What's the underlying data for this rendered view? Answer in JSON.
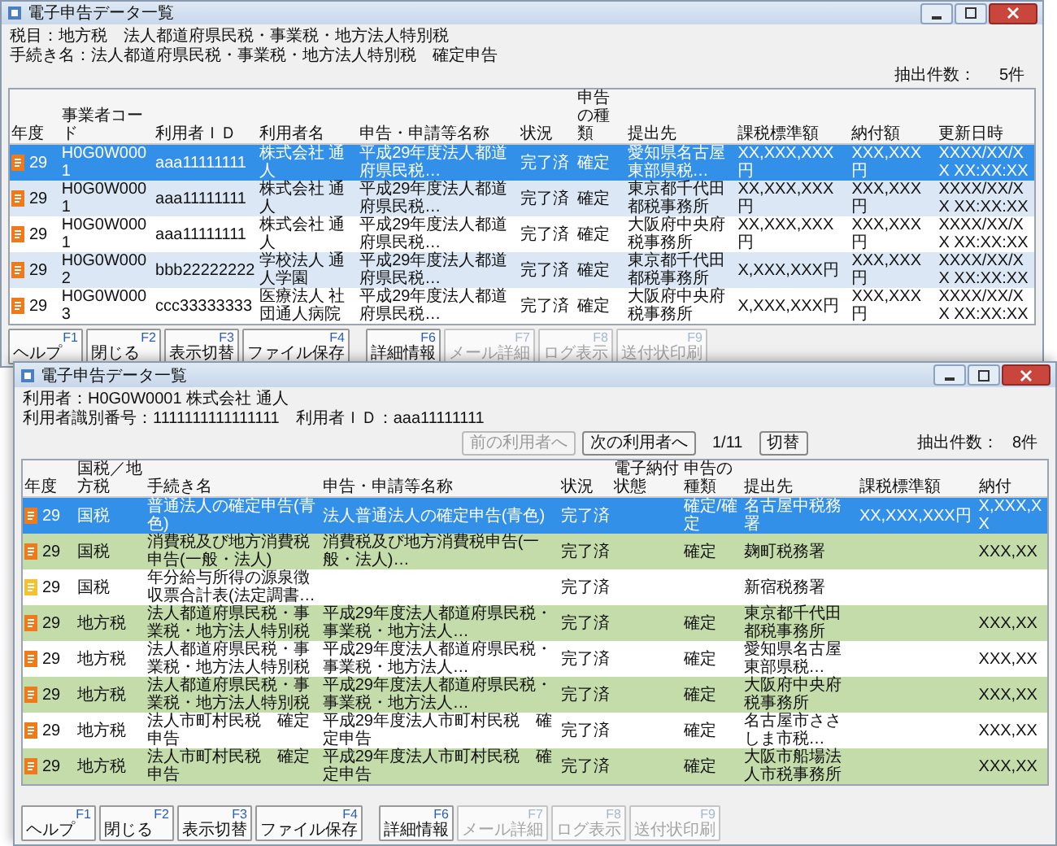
{
  "back_window": {
    "title": "電子申告データ一覧",
    "info_lines": [
      "税目：地方税　法人都道府県民税・事業税・地方法人特別税",
      "手続き名：法人都道府県民税・事業税・地方法人特別税　確定申告"
    ],
    "count_label": "抽出件数：",
    "count": "5件",
    "table": {
      "columns": [
        "年度",
        "事業者コード",
        "利用者ＩＤ",
        "利用者名",
        "申告・申請等名称",
        "状況",
        "申告の種類",
        "提出先",
        "課税標準額",
        "納付額",
        "更新日時"
      ],
      "rows": [
        {
          "selected": true,
          "kind": "report",
          "year": "29",
          "business_code": "H0G0W0001",
          "user_id": "aaa11111111",
          "user_name": "株式会社 通人",
          "report_name": "平成29年度法人都道府県民税…",
          "status": "完了済",
          "return_type": "確定",
          "submit_to": "愛知県名古屋東部県税…",
          "tax_base": "XX,XXX,XXX円",
          "tax_due": "XXX,XXX円",
          "updated": "XXXX/XX/XX XX:XX:XX"
        },
        {
          "selected": false,
          "kind": "report",
          "year": "29",
          "business_code": "H0G0W0001",
          "user_id": "aaa11111111",
          "user_name": "株式会社 通人",
          "report_name": "平成29年度法人都道府県民税…",
          "status": "完了済",
          "return_type": "確定",
          "submit_to": "東京都千代田都税事務所",
          "tax_base": "XX,XXX,XXX円",
          "tax_due": "XXX,XXX円",
          "updated": "XXXX/XX/XX XX:XX:XX"
        },
        {
          "selected": false,
          "kind": "report",
          "year": "29",
          "business_code": "H0G0W0001",
          "user_id": "aaa11111111",
          "user_name": "株式会社 通人",
          "report_name": "平成29年度法人都道府県民税…",
          "status": "完了済",
          "return_type": "確定",
          "submit_to": "大阪府中央府税事務所",
          "tax_base": "XX,XXX,XXX円",
          "tax_due": "XXX,XXX円",
          "updated": "XXXX/XX/XX XX:XX:XX"
        },
        {
          "selected": false,
          "kind": "report",
          "year": "29",
          "business_code": "H0G0W0002",
          "user_id": "bbb22222222",
          "user_name": "学校法人 通人学園",
          "report_name": "平成29年度法人都道府県民税…",
          "status": "完了済",
          "return_type": "確定",
          "submit_to": "東京都千代田都税事務所",
          "tax_base": "X,XXX,XXX円",
          "tax_due": "XXX,XXX円",
          "updated": "XXXX/XX/XX XX:XX:XX"
        },
        {
          "selected": false,
          "kind": "report",
          "year": "29",
          "business_code": "H0G0W0003",
          "user_id": "ccc33333333",
          "user_name": "医療法人 社団通人病院",
          "report_name": "平成29年度法人都道府県民税…",
          "status": "完了済",
          "return_type": "確定",
          "submit_to": "大阪府中央府税事務所",
          "tax_base": "X,XXX,XXX円",
          "tax_due": "XXX,XXX円",
          "updated": "XXXX/XX/XX XX:XX:XX"
        }
      ]
    },
    "function_key_groups": [
      {
        "keys": [
          {
            "key": "F1",
            "label": "ヘルプ",
            "disabled": false
          },
          {
            "key": "F2",
            "label": "閉じる",
            "disabled": false
          },
          {
            "key": "F3",
            "label": "表示切替",
            "disabled": false
          },
          {
            "key": "F4",
            "label": "ファイル保存",
            "disabled": false
          }
        ]
      },
      {
        "keys": [
          {
            "key": "F6",
            "label": "詳細情報",
            "disabled": false
          },
          {
            "key": "F7",
            "label": "メール詳細",
            "disabled": true
          },
          {
            "key": "F8",
            "label": "ログ表示",
            "disabled": true
          },
          {
            "key": "F9",
            "label": "送付状印刷",
            "disabled": true
          }
        ]
      }
    ]
  },
  "front_window": {
    "title": "電子申告データ一覧",
    "info_lines": [
      "利用者：H0G0W0001 株式会社 通人",
      "利用者識別番号：1111111111111111　利用者ＩＤ：aaa11111111"
    ],
    "nav_buttons": [
      {
        "label": "前の利用者へ",
        "disabled": true
      },
      {
        "label": "次の利用者へ",
        "disabled": false
      }
    ],
    "page": "1/11",
    "switch_button": "切替",
    "count_label": "抽出件数：",
    "count": "8件",
    "table": {
      "columns": [
        "年度",
        "国税／地方税",
        "手続き名",
        "申告・申請等名称",
        "状況",
        "電子納付状態",
        "申告の種類",
        "提出先",
        "課税標準額",
        "納付"
      ],
      "rows": [
        {
          "selected": true,
          "kind": "report",
          "year": "29",
          "tax_class": "国税",
          "procedure": "普通法人の確定申告(青色)",
          "report_name": "法人普通法人の確定申告(青色)",
          "status": "完了済",
          "return_type": "確定/確定",
          "submit_to": "名古屋中税務署",
          "tax_base": "XX,XXX,XXX円",
          "tax_due": "X,XXX,XX"
        },
        {
          "selected": false,
          "kind": "report",
          "year": "29",
          "tax_class": "国税",
          "procedure": "消費税及び地方消費税申告(一般・法人)",
          "report_name": "消費税及び地方消費税申告(一般・法人)…",
          "status": "完了済",
          "return_type": "確定",
          "submit_to": "麹町税務署",
          "tax_due": "XXX,XX"
        },
        {
          "selected": false,
          "kind": "notice",
          "year": "29",
          "tax_class": "国税",
          "procedure": "年分給与所得の源泉徴収票合計表(法定調書…",
          "status": "完了済",
          "submit_to": "新宿税務署"
        },
        {
          "selected": false,
          "kind": "report",
          "year": "29",
          "tax_class": "地方税",
          "procedure": "法人都道府県民税・事業税・地方法人特別税",
          "report_name": "平成29年度法人都道府県民税・事業税・地方法人…",
          "status": "完了済",
          "return_type": "確定",
          "submit_to": "東京都千代田都税事務所",
          "tax_due": "XXX,XX"
        },
        {
          "selected": false,
          "kind": "report",
          "year": "29",
          "tax_class": "地方税",
          "procedure": "法人都道府県民税・事業税・地方法人特別税",
          "report_name": "平成29年度法人都道府県民税・事業税・地方法人…",
          "status": "完了済",
          "return_type": "確定",
          "submit_to": "愛知県名古屋東部県税…",
          "tax_due": "XXX,XX"
        },
        {
          "selected": false,
          "kind": "report",
          "year": "29",
          "tax_class": "地方税",
          "procedure": "法人都道府県民税・事業税・地方法人特別税",
          "report_name": "平成29年度法人都道府県民税・事業税・地方法人…",
          "status": "完了済",
          "return_type": "確定",
          "submit_to": "大阪府中央府税事務所",
          "tax_due": "XXX,XX"
        },
        {
          "selected": false,
          "kind": "report",
          "year": "29",
          "tax_class": "地方税",
          "procedure": "法人市町村民税　確定申告",
          "report_name": "平成29年度法人市町村民税　確定申告",
          "status": "完了済",
          "return_type": "確定",
          "submit_to": "名古屋市ささしま市税…",
          "tax_due": "XXX,XX"
        },
        {
          "selected": false,
          "kind": "report",
          "year": "29",
          "tax_class": "地方税",
          "procedure": "法人市町村民税　確定申告",
          "report_name": "平成29年度法人市町村民税　確定申告",
          "status": "完了済",
          "return_type": "確定",
          "submit_to": "大阪市船場法人市税事務所",
          "tax_due": "XXX,XX"
        }
      ]
    },
    "function_key_groups": [
      {
        "keys": [
          {
            "key": "F1",
            "label": "ヘルプ",
            "disabled": false
          },
          {
            "key": "F2",
            "label": "閉じる",
            "disabled": false
          },
          {
            "key": "F3",
            "label": "表示切替",
            "disabled": false
          },
          {
            "key": "F4",
            "label": "ファイル保存",
            "disabled": false
          }
        ]
      },
      {
        "keys": [
          {
            "key": "F6",
            "label": "詳細情報",
            "disabled": false
          },
          {
            "key": "F7",
            "label": "メール詳細",
            "disabled": true
          },
          {
            "key": "F8",
            "label": "ログ表示",
            "disabled": true
          },
          {
            "key": "F9",
            "label": "送付状印刷",
            "disabled": true
          }
        ]
      }
    ]
  }
}
